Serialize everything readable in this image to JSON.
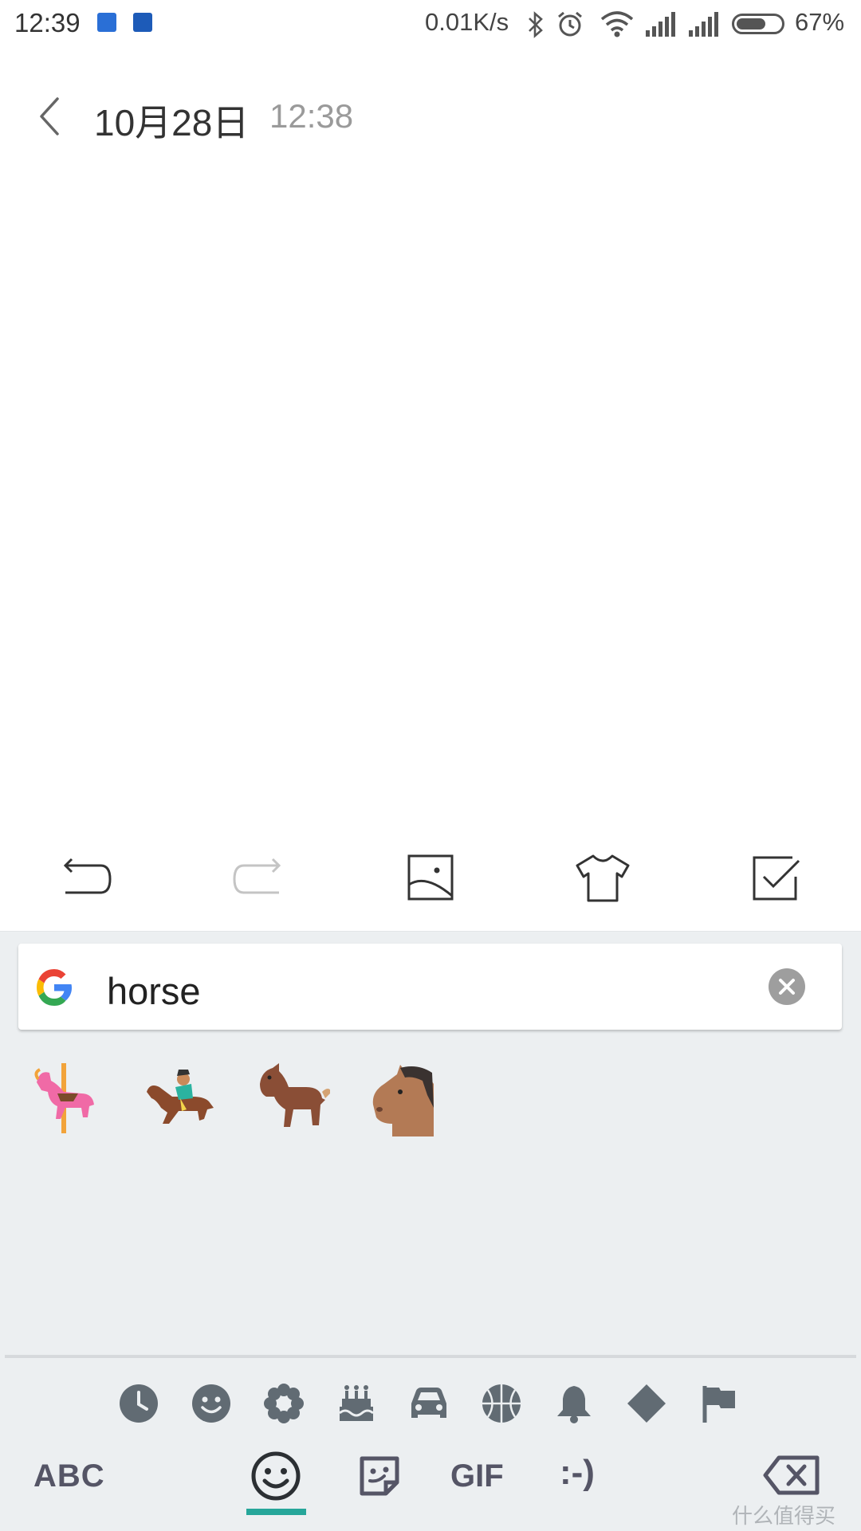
{
  "status_bar": {
    "time": "12:39",
    "net_speed": "0.01K/s",
    "battery_percent": "67%",
    "battery_level": 0.67,
    "icons": [
      "vpn-app-icon",
      "vpn-app-icon",
      "bluetooth-icon",
      "alarm-icon",
      "wifi-icon",
      "signal-icon",
      "signal-icon",
      "battery-icon"
    ]
  },
  "header": {
    "date": "10月28日",
    "time": "12:38"
  },
  "editor_toolbar": {
    "tools": [
      "undo-icon",
      "redo-icon",
      "image-icon",
      "theme-shirt-icon",
      "checklist-icon"
    ]
  },
  "keyboard": {
    "search": {
      "query": "horse"
    },
    "emoji_results": [
      "🎠",
      "🏇",
      "🐎",
      "🐴"
    ],
    "categories": [
      "recent-icon",
      "smiley-icon",
      "flower-icon",
      "cake-icon",
      "car-icon",
      "basketball-icon",
      "bell-icon",
      "diamond-icon",
      "flag-icon"
    ],
    "bottom_bar": {
      "abc_label": "ABC",
      "gif_label": "GIF",
      "emoticon_label": ":-)"
    },
    "accent_color": "#26a69a"
  },
  "watermark": "什么值得买"
}
